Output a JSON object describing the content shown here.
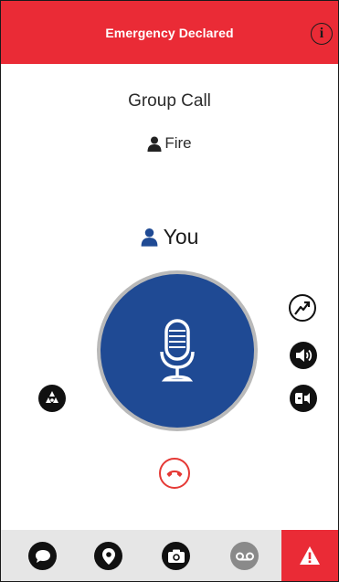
{
  "header": {
    "title": "Emergency Declared",
    "info_icon": "i"
  },
  "call": {
    "type_label": "Group Call",
    "group_name": "Fire",
    "talker_name": "You"
  },
  "colors": {
    "emergency_red": "#ea2b36",
    "ptt_blue": "#1f4a94",
    "talker_icon_blue": "#1f4a94",
    "end_call_red": "#e53935",
    "bottom_bar_bg": "#e6e6e6"
  },
  "icons": {
    "group": "person-icon",
    "talker": "person-icon",
    "ptt": "microphone-icon",
    "right_top": "signal-trend-icon",
    "right_middle": "speaker-icon",
    "right_bottom": "earpiece-icon",
    "left": "map-group-icon",
    "end_call": "phone-hangup-icon",
    "tabs": [
      "chat-icon",
      "location-pin-icon",
      "camera-icon",
      "voicemail-icon",
      "alert-triangle-icon"
    ]
  }
}
